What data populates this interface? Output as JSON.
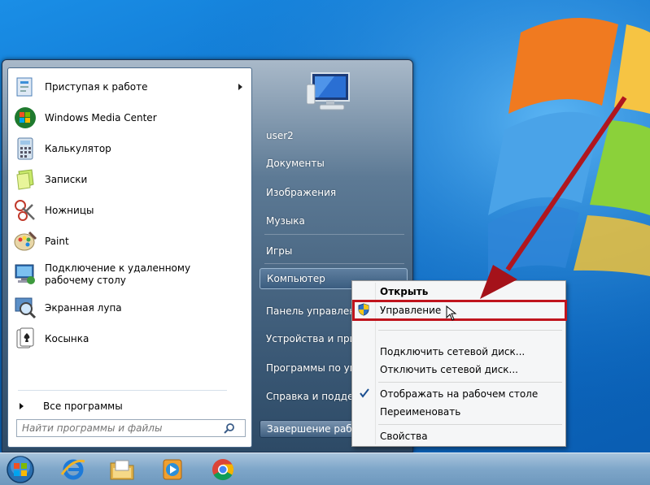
{
  "programs": [
    {
      "label": "Приступая к работе",
      "icon": "getting-started-icon",
      "submenu": true
    },
    {
      "label": "Windows Media Center",
      "icon": "media-center-icon"
    },
    {
      "label": "Калькулятор",
      "icon": "calculator-icon"
    },
    {
      "label": "Записки",
      "icon": "sticky-notes-icon"
    },
    {
      "label": "Ножницы",
      "icon": "scissors-icon"
    },
    {
      "label": "Paint",
      "icon": "paint-icon"
    },
    {
      "label": "Подключение к удаленному рабочему столу",
      "icon": "remote-desktop-icon"
    },
    {
      "label": "Экранная лупа",
      "icon": "magnifier-icon"
    },
    {
      "label": "Косынка",
      "icon": "solitaire-icon"
    }
  ],
  "all_programs": "Все программы",
  "search": {
    "placeholder": "Найти программы и файлы"
  },
  "right_pane": {
    "user": "user2",
    "documents": "Документы",
    "pictures": "Изображения",
    "music": "Музыка",
    "games": "Игры",
    "computer": "Компьютер",
    "control_panel": "Панель управления",
    "devices": "Устройства и принтеры",
    "default_programs": "Программы по умолчанию",
    "help": "Справка и поддержка",
    "shutdown": "Завершение работы"
  },
  "context_menu": {
    "open": "Открыть",
    "manage": "Управление",
    "map_drive": "Подключить сетевой диск...",
    "disconnect_drive": "Отключить сетевой диск...",
    "show_on_desktop": "Отображать на рабочем столе",
    "rename": "Переименовать",
    "properties": "Свойства"
  },
  "colors": {
    "highlight": "#c0141d",
    "arrow": "#b8141c"
  }
}
